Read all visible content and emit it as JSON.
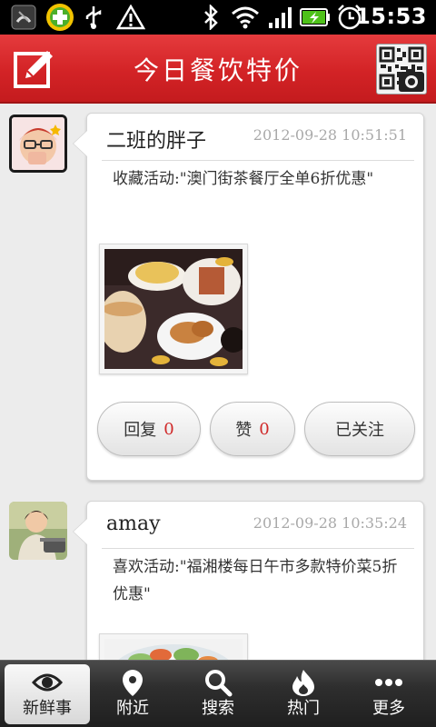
{
  "status_bar": {
    "time": "15:53",
    "icons": [
      "missed-call-icon",
      "security-app-icon",
      "usb-icon",
      "warning-icon",
      "bluetooth-icon",
      "wifi-icon",
      "signal-icon",
      "battery-charging-icon",
      "alarm-icon"
    ]
  },
  "header": {
    "title": "今日餐饮特价",
    "left_button_icon": "compose-icon",
    "right_button_icon": "qr-scan-icon"
  },
  "feed": [
    {
      "user": "二班的胖子",
      "timestamp": "2012-09-28 10:51:51",
      "text": "收藏活动:\"澳门街茶餐厅全单6折优惠\"",
      "has_photo": true,
      "actions": {
        "reply_label": "回复",
        "reply_count": "0",
        "like_label": "赞",
        "like_count": "0",
        "follow_label": "已关注"
      }
    },
    {
      "user": "amay",
      "timestamp": "2012-09-28 10:35:24",
      "text": "喜欢活动:\"福湘楼每日午市多款特价菜5折优惠\"",
      "has_photo": true
    }
  ],
  "bottom_nav": [
    {
      "label": "新鲜事",
      "icon": "eye-icon",
      "active": true
    },
    {
      "label": "附近",
      "icon": "location-pin-icon",
      "active": false
    },
    {
      "label": "搜索",
      "icon": "search-icon",
      "active": false
    },
    {
      "label": "热门",
      "icon": "flame-icon",
      "active": false
    },
    {
      "label": "更多",
      "icon": "more-dots-icon",
      "active": false
    }
  ],
  "colors": {
    "header_red": "#d32326",
    "count_red": "#d02a2a",
    "timestamp_gray": "#a9a9a9",
    "nav_dark": "#2e2e2e"
  }
}
